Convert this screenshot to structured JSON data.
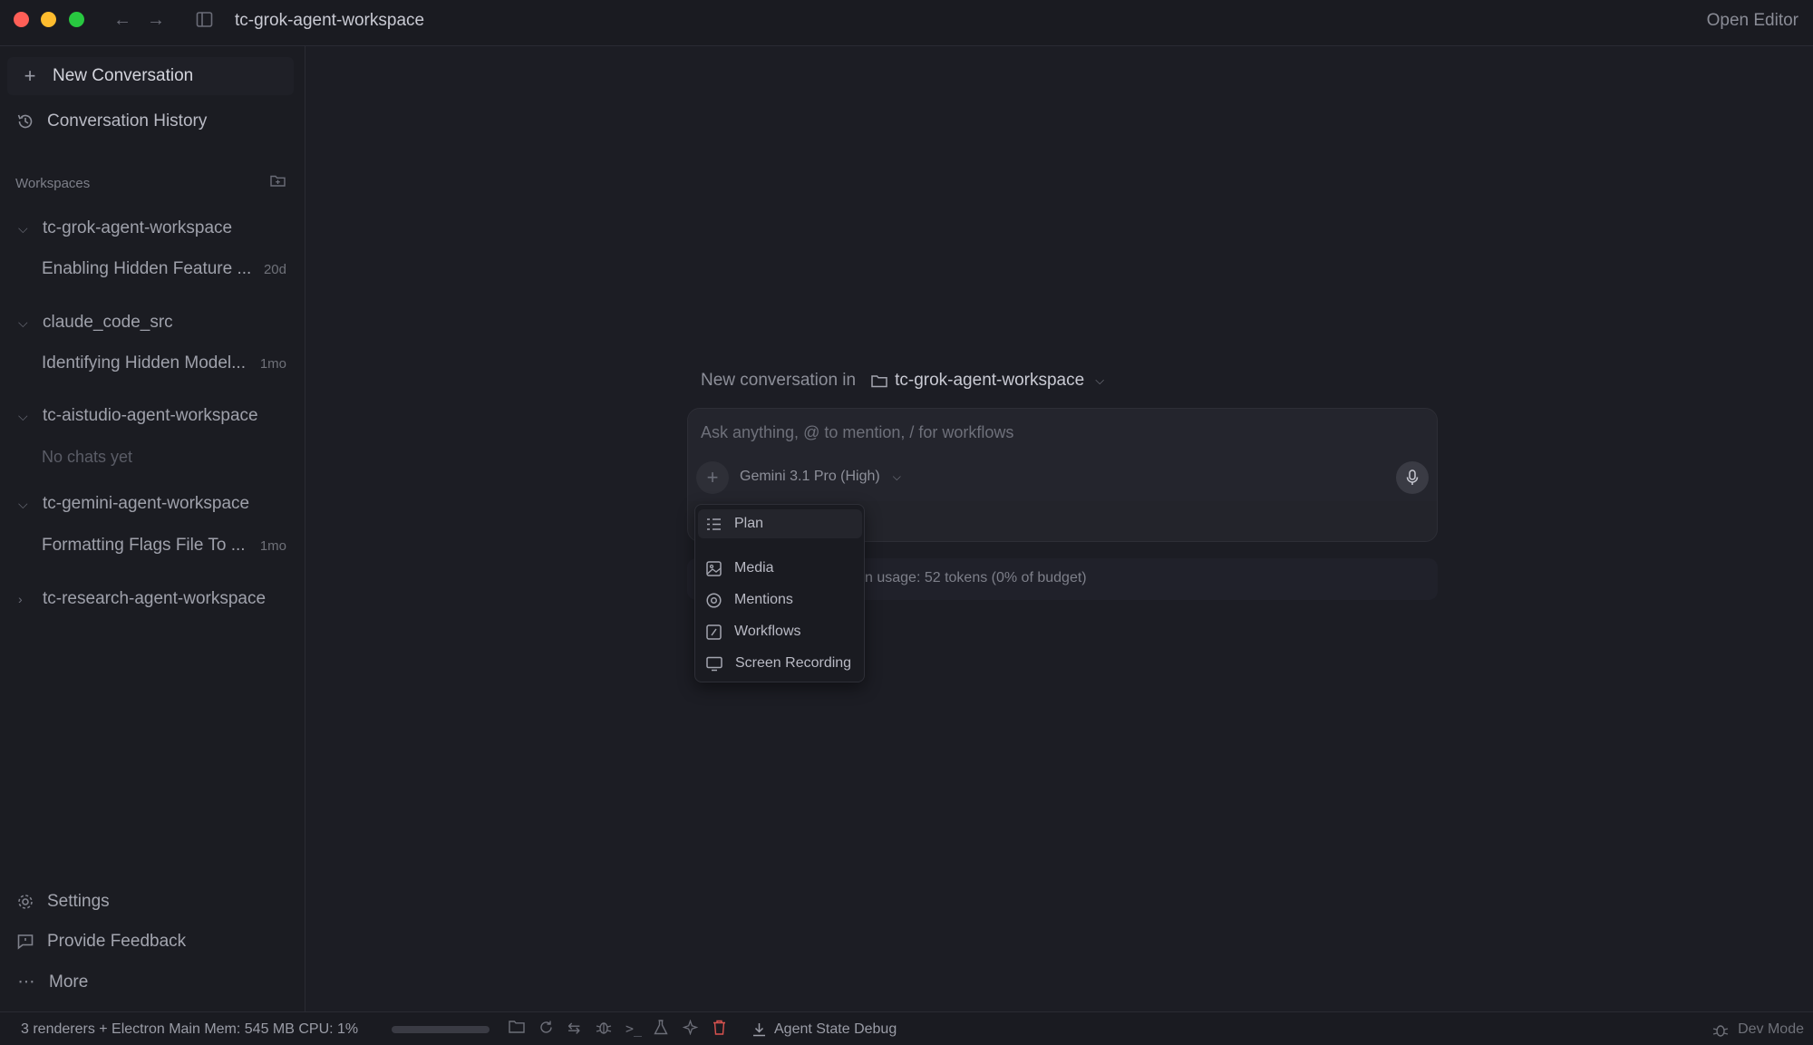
{
  "window": {
    "title": "tc-grok-agent-workspace",
    "open_editor": "Open Editor",
    "back_icon": "←",
    "forward_icon": "→"
  },
  "sidebar": {
    "new_conversation": "New Conversation",
    "conversation_history": "Conversation History",
    "workspaces_header": "Workspaces",
    "workspaces": [
      {
        "name": "tc-grok-agent-workspace",
        "expanded": true,
        "chats": [
          {
            "title": "Enabling Hidden Feature ...",
            "age": "20d"
          }
        ]
      },
      {
        "name": "claude_code_src",
        "expanded": true,
        "chats": [
          {
            "title": "Identifying Hidden Model...",
            "age": "1mo"
          }
        ]
      },
      {
        "name": "tc-aistudio-agent-workspace",
        "expanded": true,
        "empty_text": "No chats yet"
      },
      {
        "name": "tc-gemini-agent-workspace",
        "expanded": true,
        "chats": [
          {
            "title": "Formatting Flags File To ...",
            "age": "1mo"
          }
        ]
      },
      {
        "name": "tc-research-agent-workspace",
        "expanded": false
      }
    ],
    "settings": "Settings",
    "feedback": "Provide Feedback",
    "more": "More"
  },
  "main": {
    "new_conv_label": "New conversation in",
    "workspace_chip": "tc-grok-agent-workspace",
    "input_placeholder": "Ask anything, @ to mention, / for workflows",
    "model": "Gemini 3.1 Pro (High)",
    "usage_text": "n usage: 52 tokens (0% of budget)"
  },
  "dropdown": {
    "items": [
      "Plan",
      "Media",
      "Mentions",
      "Workflows",
      "Screen Recording"
    ],
    "selected": "Plan"
  },
  "statusbar": {
    "info": "3 renderers + Electron Main Mem: 545 MB CPU: 1%",
    "mem_fraction": 0.0,
    "agent_state_debug": "Agent State Debug",
    "dev_mode": "Dev Mode"
  },
  "colors": {
    "background": "#1c1d24",
    "sidebar": "#1b1c22",
    "traffic_red": "#ff5f57",
    "traffic_yellow": "#febc2e",
    "traffic_green": "#28c840",
    "trash_icon": "#d9534f"
  }
}
